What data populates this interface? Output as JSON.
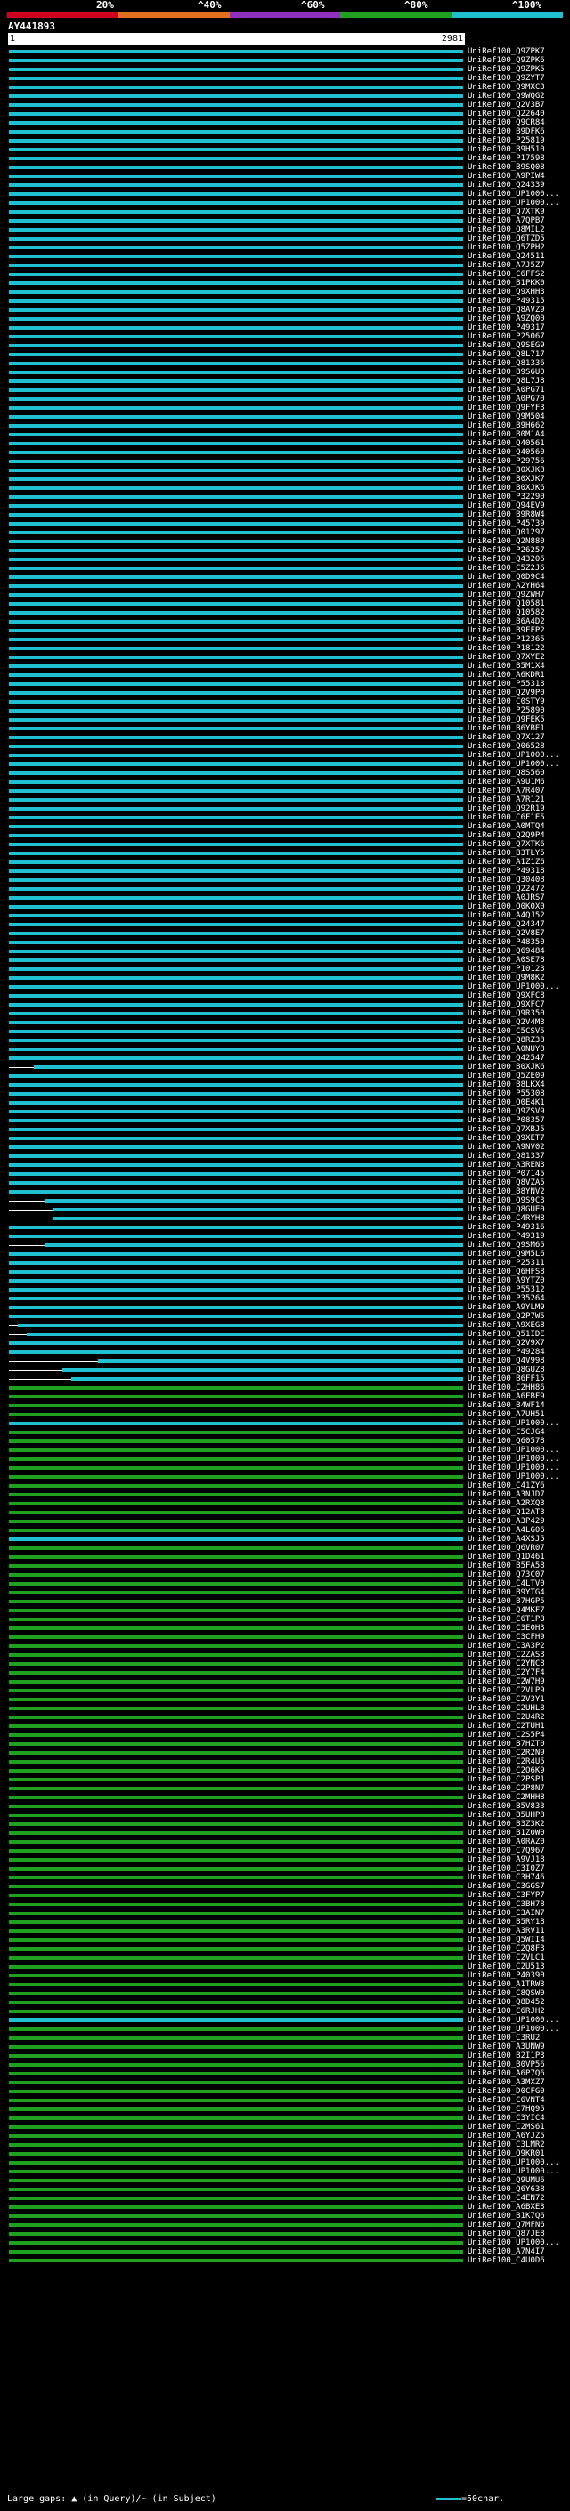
{
  "legend_scale": {
    "labels": [
      "20%",
      "^40%",
      "^60%",
      "^80%",
      "^100%"
    ],
    "colors": [
      "#d00020",
      "#e07020",
      "#9030c0",
      "#20a020",
      "#20c0d0"
    ]
  },
  "query": {
    "title": "AY441893",
    "start": "1",
    "end": "2981"
  },
  "hits": [
    {
      "label": "UniRef100_Q9ZPK7",
      "color": "#20c0d0"
    },
    {
      "label": "UniRef100_Q9ZPK6",
      "color": "#20c0d0"
    },
    {
      "label": "UniRef100_Q9ZPK5",
      "color": "#20c0d0"
    },
    {
      "label": "UniRef100_Q9ZYT7",
      "color": "#20c0d0"
    },
    {
      "label": "UniRef100_Q9MXC3",
      "color": "#20c0d0"
    },
    {
      "label": "UniRef100_Q9WQG2",
      "color": "#20c0d0"
    },
    {
      "label": "UniRef100_Q2V3B7",
      "color": "#20c0d0"
    },
    {
      "label": "UniRef100_Q22640",
      "color": "#20c0d0"
    },
    {
      "label": "UniRef100_Q9CR84",
      "color": "#20c0d0"
    },
    {
      "label": "UniRef100_B9DFK6",
      "color": "#20c0d0"
    },
    {
      "label": "UniRef100_P25819",
      "color": "#20c0d0"
    },
    {
      "label": "UniRef100_B9H510",
      "color": "#20c0d0"
    },
    {
      "label": "UniRef100_P17598",
      "color": "#20c0d0"
    },
    {
      "label": "UniRef100_B9SQ08",
      "color": "#20c0d0"
    },
    {
      "label": "UniRef100_A9PIW4",
      "color": "#20c0d0"
    },
    {
      "label": "UniRef100_Q24339",
      "color": "#20c0d0"
    },
    {
      "label": "UniRef100_UP1000...",
      "color": "#20c0d0"
    },
    {
      "label": "UniRef100_UP1000...",
      "color": "#20c0d0"
    },
    {
      "label": "UniRef100_Q7XTK9",
      "color": "#20c0d0"
    },
    {
      "label": "UniRef100_A7QPB7",
      "color": "#20c0d0"
    },
    {
      "label": "UniRef100_Q8MIL2",
      "color": "#20c0d0"
    },
    {
      "label": "UniRef100_Q6TZD5",
      "color": "#20c0d0"
    },
    {
      "label": "UniRef100_Q5ZPH2",
      "color": "#20c0d0"
    },
    {
      "label": "UniRef100_Q24511",
      "color": "#20c0d0"
    },
    {
      "label": "UniRef100_A7J5Z7",
      "color": "#20c0d0"
    },
    {
      "label": "UniRef100_C6FFS2",
      "color": "#20c0d0"
    },
    {
      "label": "UniRef100_B1PKK0",
      "color": "#20c0d0"
    },
    {
      "label": "UniRef100_Q9XHH3",
      "color": "#20c0d0"
    },
    {
      "label": "UniRef100_P49315",
      "color": "#20c0d0"
    },
    {
      "label": "UniRef100_Q8AVZ9",
      "color": "#20c0d0"
    },
    {
      "label": "UniRef100_A9ZQ00",
      "color": "#20c0d0"
    },
    {
      "label": "UniRef100_P49317",
      "color": "#20c0d0"
    },
    {
      "label": "UniRef100_P25067",
      "color": "#20c0d0"
    },
    {
      "label": "UniRef100_Q9SEG9",
      "color": "#20c0d0"
    },
    {
      "label": "UniRef100_Q8L717",
      "color": "#20c0d0"
    },
    {
      "label": "UniRef100_Q81336",
      "color": "#20c0d0"
    },
    {
      "label": "UniRef100_B9S6U0",
      "color": "#20c0d0"
    },
    {
      "label": "UniRef100_Q8L7J8",
      "color": "#20c0d0"
    },
    {
      "label": "UniRef100_A0PG71",
      "color": "#20c0d0"
    },
    {
      "label": "UniRef100_A0PG70",
      "color": "#20c0d0"
    },
    {
      "label": "UniRef100_Q9FYF3",
      "color": "#20c0d0"
    },
    {
      "label": "UniRef100_Q9M504",
      "color": "#20c0d0"
    },
    {
      "label": "UniRef100_B9H662",
      "color": "#20c0d0"
    },
    {
      "label": "UniRef100_B0M1A4",
      "color": "#20c0d0"
    },
    {
      "label": "UniRef100_Q40561",
      "color": "#20c0d0"
    },
    {
      "label": "UniRef100_Q40560",
      "color": "#20c0d0"
    },
    {
      "label": "UniRef100_P29756",
      "color": "#20c0d0"
    },
    {
      "label": "UniRef100_B0XJK8",
      "color": "#20c0d0"
    },
    {
      "label": "UniRef100_B0XJK7",
      "color": "#20c0d0"
    },
    {
      "label": "UniRef100_B0XJK6",
      "color": "#20c0d0"
    },
    {
      "label": "UniRef100_P32290",
      "color": "#20c0d0"
    },
    {
      "label": "UniRef100_Q94EV9",
      "color": "#20c0d0"
    },
    {
      "label": "UniRef100_B9R8W4",
      "color": "#20c0d0"
    },
    {
      "label": "UniRef100_P45739",
      "color": "#20c0d0"
    },
    {
      "label": "UniRef100_Q01297",
      "color": "#20c0d0"
    },
    {
      "label": "UniRef100_Q2N880",
      "color": "#20c0d0"
    },
    {
      "label": "UniRef100_P26257",
      "color": "#20c0d0"
    },
    {
      "label": "UniRef100_Q43206",
      "color": "#20c0d0"
    },
    {
      "label": "UniRef100_C5Z2J6",
      "color": "#20c0d0"
    },
    {
      "label": "UniRef100_Q0D9C4",
      "color": "#20c0d0"
    },
    {
      "label": "UniRef100_A2YH64",
      "color": "#20c0d0"
    },
    {
      "label": "UniRef100_Q9ZWH7",
      "color": "#20c0d0"
    },
    {
      "label": "UniRef100_Q10581",
      "color": "#20c0d0"
    },
    {
      "label": "UniRef100_Q10582",
      "color": "#20c0d0"
    },
    {
      "label": "UniRef100_B6A4D2",
      "color": "#20c0d0"
    },
    {
      "label": "UniRef100_B9FFP2",
      "color": "#20c0d0"
    },
    {
      "label": "UniRef100_P12365",
      "color": "#20c0d0"
    },
    {
      "label": "UniRef100_P18122",
      "color": "#20c0d0"
    },
    {
      "label": "UniRef100_Q7XYE2",
      "color": "#20c0d0"
    },
    {
      "label": "UniRef100_B5M1X4",
      "color": "#20c0d0"
    },
    {
      "label": "UniRef100_A6KDR1",
      "color": "#20c0d0"
    },
    {
      "label": "UniRef100_P55313",
      "color": "#20c0d0"
    },
    {
      "label": "UniRef100_Q2V9P0",
      "color": "#20c0d0"
    },
    {
      "label": "UniRef100_C0STY9",
      "color": "#20c0d0"
    },
    {
      "label": "UniRef100_P25890",
      "color": "#20c0d0"
    },
    {
      "label": "UniRef100_Q9FEK5",
      "color": "#20c0d0"
    },
    {
      "label": "UniRef100_B6YBE1",
      "color": "#20c0d0"
    },
    {
      "label": "UniRef100_Q7X127",
      "color": "#20c0d0"
    },
    {
      "label": "UniRef100_Q06528",
      "color": "#20c0d0"
    },
    {
      "label": "UniRef100_UP1000...",
      "color": "#20c0d0"
    },
    {
      "label": "UniRef100_UP1000...",
      "color": "#20c0d0"
    },
    {
      "label": "UniRef100_Q8S560",
      "color": "#20c0d0"
    },
    {
      "label": "UniRef100_A9U1M6",
      "color": "#20c0d0"
    },
    {
      "label": "UniRef100_A7R407",
      "color": "#20c0d0"
    },
    {
      "label": "UniRef100_A7R121",
      "color": "#20c0d0"
    },
    {
      "label": "UniRef100_Q92R19",
      "color": "#20c0d0"
    },
    {
      "label": "UniRef100_C6F1E5",
      "color": "#20c0d0"
    },
    {
      "label": "UniRef100_A0MTQ4",
      "color": "#20c0d0"
    },
    {
      "label": "UniRef100_Q2Q9P4",
      "color": "#20c0d0"
    },
    {
      "label": "UniRef100_Q7XTK6",
      "color": "#20c0d0"
    },
    {
      "label": "UniRef100_B3TLY5",
      "color": "#20c0d0"
    },
    {
      "label": "UniRef100_A1Z1Z6",
      "color": "#20c0d0"
    },
    {
      "label": "UniRef100_P49318",
      "color": "#20c0d0"
    },
    {
      "label": "UniRef100_Q30408",
      "color": "#20c0d0"
    },
    {
      "label": "UniRef100_Q22472",
      "color": "#20c0d0"
    },
    {
      "label": "UniRef100_A0JRS7",
      "color": "#20c0d0"
    },
    {
      "label": "UniRef100_Q0K0X0",
      "color": "#20c0d0"
    },
    {
      "label": "UniRef100_A4QJ52",
      "color": "#20c0d0"
    },
    {
      "label": "UniRef100_Q24347",
      "color": "#20c0d0"
    },
    {
      "label": "UniRef100_Q2V8E7",
      "color": "#20c0d0"
    },
    {
      "label": "UniRef100_P48350",
      "color": "#20c0d0"
    },
    {
      "label": "UniRef100_Q69484",
      "color": "#20c0d0"
    },
    {
      "label": "UniRef100_A0SE78",
      "color": "#20c0d0"
    },
    {
      "label": "UniRef100_P10123",
      "color": "#20c0d0"
    },
    {
      "label": "UniRef100_Q9M8K2",
      "color": "#20c0d0"
    },
    {
      "label": "UniRef100_UP1000...",
      "color": "#20c0d0"
    },
    {
      "label": "UniRef100_Q9XFC8",
      "color": "#20c0d0"
    },
    {
      "label": "UniRef100_Q9XFC7",
      "color": "#20c0d0"
    },
    {
      "label": "UniRef100_Q9R350",
      "color": "#20c0d0"
    },
    {
      "label": "UniRef100_Q2V4M3",
      "color": "#20c0d0"
    },
    {
      "label": "UniRef100_C5CSV5",
      "color": "#20c0d0"
    },
    {
      "label": "UniRef100_Q8RZ38",
      "color": "#20c0d0"
    },
    {
      "label": "UniRef100_A0NUY8",
      "color": "#20c0d0"
    },
    {
      "label": "UniRef100_Q42547",
      "color": "#20c0d0"
    },
    {
      "label": "UniRef100_B0XJK6",
      "color": "#20c0d0",
      "gap": [
        0,
        28
      ]
    },
    {
      "label": "UniRef100_Q5ZE09",
      "color": "#20c0d0"
    },
    {
      "label": "UniRef100_B8LKX4",
      "color": "#20c0d0"
    },
    {
      "label": "UniRef100_P55308",
      "color": "#20c0d0"
    },
    {
      "label": "UniRef100_Q0E4K1",
      "color": "#20c0d0"
    },
    {
      "label": "UniRef100_Q9ZSV9",
      "color": "#20c0d0"
    },
    {
      "label": "UniRef100_P08357",
      "color": "#20c0d0"
    },
    {
      "label": "UniRef100_Q7XBJ5",
      "color": "#20c0d0"
    },
    {
      "label": "UniRef100_Q9XET7",
      "color": "#20c0d0"
    },
    {
      "label": "UniRef100_A9NV02",
      "color": "#20c0d0"
    },
    {
      "label": "UniRef100_Q81337",
      "color": "#20c0d0"
    },
    {
      "label": "UniRef100_A3REN3",
      "color": "#20c0d0"
    },
    {
      "label": "UniRef100_P07145",
      "color": "#20c0d0"
    },
    {
      "label": "UniRef100_Q8VZA5",
      "color": "#20c0d0"
    },
    {
      "label": "UniRef100_B8YNV2",
      "color": "#20c0d0"
    },
    {
      "label": "UniRef100_Q9S9C3",
      "color": "#20c0d0",
      "gap": [
        0,
        40
      ]
    },
    {
      "label": "UniRef100_Q8GUE0",
      "color": "#20c0d0",
      "gap": [
        0,
        50
      ]
    },
    {
      "label": "UniRef100_C4RYH8",
      "color": "#20c0d0",
      "gap": [
        0,
        50
      ]
    },
    {
      "label": "UniRef100_P49316",
      "color": "#20c0d0"
    },
    {
      "label": "UniRef100_P49319",
      "color": "#20c0d0"
    },
    {
      "label": "UniRef100_Q9SM65",
      "color": "#20c0d0",
      "gap": [
        0,
        40
      ]
    },
    {
      "label": "UniRef100_Q9M5L6",
      "color": "#20c0d0"
    },
    {
      "label": "UniRef100_P25311",
      "color": "#20c0d0"
    },
    {
      "label": "UniRef100_Q6HFS8",
      "color": "#20c0d0"
    },
    {
      "label": "UniRef100_A9YTZ0",
      "color": "#20c0d0"
    },
    {
      "label": "UniRef100_P55312",
      "color": "#20c0d0"
    },
    {
      "label": "UniRef100_P35264",
      "color": "#20c0d0"
    },
    {
      "label": "UniRef100_A9YLM9",
      "color": "#20c0d0"
    },
    {
      "label": "UniRef100_Q2P7W5",
      "color": "#20c0d0"
    },
    {
      "label": "UniRef100_A9XEG8",
      "color": "#20c0d0",
      "gap": [
        0,
        10
      ]
    },
    {
      "label": "UniRef100_Q51IDE",
      "color": "#20c0d0",
      "gap": [
        0,
        20
      ]
    },
    {
      "label": "UniRef100_Q2V9X7",
      "color": "#20c0d0"
    },
    {
      "label": "UniRef100_P49284",
      "color": "#20c0d0"
    },
    {
      "label": "UniRef100_Q4V998",
      "color": "#20c0d0",
      "gap": [
        0,
        100
      ]
    },
    {
      "label": "UniRef100_Q8GUZ8",
      "color": "#20c0d0",
      "gap": [
        0,
        60
      ]
    },
    {
      "label": "UniRef100_B6FF15",
      "color": "#20c0d0",
      "gap": [
        0,
        70
      ]
    },
    {
      "label": "UniRef100_C2HH86",
      "color": "#20a020"
    },
    {
      "label": "UniRef100_A6FBF9",
      "color": "#20a020"
    },
    {
      "label": "UniRef100_B4WF14",
      "color": "#20a020"
    },
    {
      "label": "UniRef100_A7UH51",
      "color": "#20a020"
    },
    {
      "label": "UniRef100_UP1000...",
      "color": "#20c0d0"
    },
    {
      "label": "UniRef100_C5CJG4",
      "color": "#20a020"
    },
    {
      "label": "UniRef100_Q60578",
      "color": "#20a020"
    },
    {
      "label": "UniRef100_UP1000...",
      "color": "#20a020"
    },
    {
      "label": "UniRef100_UP1000...",
      "color": "#20a020"
    },
    {
      "label": "UniRef100_UP1000...",
      "color": "#20a020"
    },
    {
      "label": "UniRef100_UP1000...",
      "color": "#20a020"
    },
    {
      "label": "UniRef100_C41ZY6",
      "color": "#20a020"
    },
    {
      "label": "UniRef100_A3NJD7",
      "color": "#20a020"
    },
    {
      "label": "UniRef100_A2RXQ3",
      "color": "#20a020"
    },
    {
      "label": "UniRef100_Q12AT3",
      "color": "#20a020"
    },
    {
      "label": "UniRef100_A3P429",
      "color": "#20a020"
    },
    {
      "label": "UniRef100_A4LG06",
      "color": "#20a020"
    },
    {
      "label": "UniRef100_A4XSJ5",
      "color": "#20c0d0"
    },
    {
      "label": "UniRef100_Q6VR07",
      "color": "#20a020"
    },
    {
      "label": "UniRef100_Q1D461",
      "color": "#20a020"
    },
    {
      "label": "UniRef100_B5FA58",
      "color": "#20a020"
    },
    {
      "label": "UniRef100_Q73C07",
      "color": "#20a020"
    },
    {
      "label": "UniRef100_C4LTV0",
      "color": "#20a020"
    },
    {
      "label": "UniRef100_B9YTG4",
      "color": "#20a020"
    },
    {
      "label": "UniRef100_B7HGP5",
      "color": "#20a020"
    },
    {
      "label": "UniRef100_Q4MKF7",
      "color": "#20a020"
    },
    {
      "label": "UniRef100_C6T1P8",
      "color": "#20a020"
    },
    {
      "label": "UniRef100_C3E0H3",
      "color": "#20a020"
    },
    {
      "label": "UniRef100_C3CFH9",
      "color": "#20a020"
    },
    {
      "label": "UniRef100_C3A3P2",
      "color": "#20a020"
    },
    {
      "label": "UniRef100_C2ZAS3",
      "color": "#20a020"
    },
    {
      "label": "UniRef100_C2YNC8",
      "color": "#20a020"
    },
    {
      "label": "UniRef100_C2Y7F4",
      "color": "#20a020"
    },
    {
      "label": "UniRef100_C2W7H9",
      "color": "#20a020"
    },
    {
      "label": "UniRef100_C2VLP9",
      "color": "#20a020"
    },
    {
      "label": "UniRef100_C2V3Y1",
      "color": "#20a020"
    },
    {
      "label": "UniRef100_C2UHL8",
      "color": "#20a020"
    },
    {
      "label": "UniRef100_C2U4R2",
      "color": "#20a020"
    },
    {
      "label": "UniRef100_C2TUH1",
      "color": "#20a020"
    },
    {
      "label": "UniRef100_C2S5P4",
      "color": "#20a020"
    },
    {
      "label": "UniRef100_B7HZT0",
      "color": "#20a020"
    },
    {
      "label": "UniRef100_C2R2N9",
      "color": "#20a020"
    },
    {
      "label": "UniRef100_C2R4U5",
      "color": "#20a020"
    },
    {
      "label": "UniRef100_C2Q6K9",
      "color": "#20a020"
    },
    {
      "label": "UniRef100_C2PSP1",
      "color": "#20a020"
    },
    {
      "label": "UniRef100_C2P8N7",
      "color": "#20a020"
    },
    {
      "label": "UniRef100_C2MHH8",
      "color": "#20a020"
    },
    {
      "label": "UniRef100_B5V833",
      "color": "#20a020"
    },
    {
      "label": "UniRef100_B5UHP8",
      "color": "#20a020"
    },
    {
      "label": "UniRef100_B3Z3K2",
      "color": "#20a020"
    },
    {
      "label": "UniRef100_B1Z0W0",
      "color": "#20a020"
    },
    {
      "label": "UniRef100_A0RAZ0",
      "color": "#20a020"
    },
    {
      "label": "UniRef100_C7Q967",
      "color": "#20a020"
    },
    {
      "label": "UniRef100_A9VJ18",
      "color": "#20a020"
    },
    {
      "label": "UniRef100_C3I0Z7",
      "color": "#20a020"
    },
    {
      "label": "UniRef100_C3H746",
      "color": "#20a020"
    },
    {
      "label": "UniRef100_C3GGS7",
      "color": "#20a020"
    },
    {
      "label": "UniRef100_C3FYP7",
      "color": "#20a020"
    },
    {
      "label": "UniRef100_C3BH78",
      "color": "#20a020"
    },
    {
      "label": "UniRef100_C3AIN7",
      "color": "#20a020"
    },
    {
      "label": "UniRef100_B5RY18",
      "color": "#20a020"
    },
    {
      "label": "UniRef100_A3RV11",
      "color": "#20a020"
    },
    {
      "label": "UniRef100_Q5WII4",
      "color": "#20a020"
    },
    {
      "label": "UniRef100_C2Q8F3",
      "color": "#20a020"
    },
    {
      "label": "UniRef100_C2VLC1",
      "color": "#20a020"
    },
    {
      "label": "UniRef100_C2U513",
      "color": "#20a020"
    },
    {
      "label": "UniRef100_P40390",
      "color": "#20a020"
    },
    {
      "label": "UniRef100_A1TRW3",
      "color": "#20a020"
    },
    {
      "label": "UniRef100_C8QSW0",
      "color": "#20a020"
    },
    {
      "label": "UniRef100_Q8D452",
      "color": "#20a020"
    },
    {
      "label": "UniRef100_C6RJH2",
      "color": "#20a020"
    },
    {
      "label": "UniRef100_UP1000...",
      "color": "#20c0d0"
    },
    {
      "label": "UniRef100_UP1000...",
      "color": "#20a020"
    },
    {
      "label": "UniRef100_C3RU2",
      "color": "#20a020"
    },
    {
      "label": "UniRef100_A3UNW9",
      "color": "#20a020"
    },
    {
      "label": "UniRef100_B2I1P3",
      "color": "#20a020"
    },
    {
      "label": "UniRef100_B0VP56",
      "color": "#20a020"
    },
    {
      "label": "UniRef100_A6P7Q6",
      "color": "#20a020"
    },
    {
      "label": "UniRef100_A3MXZ7",
      "color": "#20a020"
    },
    {
      "label": "UniRef100_D0CFG0",
      "color": "#20a020"
    },
    {
      "label": "UniRef100_C6VNT4",
      "color": "#20a020"
    },
    {
      "label": "UniRef100_C7HQ95",
      "color": "#20a020"
    },
    {
      "label": "UniRef100_C3YIC4",
      "color": "#20a020"
    },
    {
      "label": "UniRef100_C2MS61",
      "color": "#20a020"
    },
    {
      "label": "UniRef100_A6YJZ5",
      "color": "#20a020"
    },
    {
      "label": "UniRef100_C3LMR2",
      "color": "#20a020"
    },
    {
      "label": "UniRef100_Q9KR01",
      "color": "#20a020"
    },
    {
      "label": "UniRef100_UP1000...",
      "color": "#20a020"
    },
    {
      "label": "UniRef100_UP1000...",
      "color": "#20a020"
    },
    {
      "label": "UniRef100_Q9UMU6",
      "color": "#20a020"
    },
    {
      "label": "UniRef100_Q6Y638",
      "color": "#20a020"
    },
    {
      "label": "UniRef100_C4EN72",
      "color": "#20a020"
    },
    {
      "label": "UniRef100_A6BXE3",
      "color": "#20a020"
    },
    {
      "label": "UniRef100_B1K7Q6",
      "color": "#20a020"
    },
    {
      "label": "UniRef100_Q7MFN6",
      "color": "#20a020"
    },
    {
      "label": "UniRef100_Q87JE8",
      "color": "#20a020"
    },
    {
      "label": "UniRef100_UP1000...",
      "color": "#20a020"
    },
    {
      "label": "UniRef100_A7N4I7",
      "color": "#20a020"
    },
    {
      "label": "UniRef100_C4U0D6",
      "color": "#20a020"
    }
  ],
  "legend": {
    "left": "Large gaps: ▲ (in Query)/~ (in Subject)",
    "right": "=50char."
  }
}
